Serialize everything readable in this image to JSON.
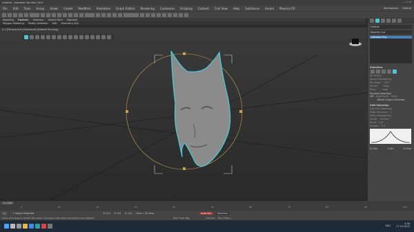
{
  "window": {
    "title": "Untitled - Autodesk 3ds Max 2023"
  },
  "menu": [
    "File",
    "Edit",
    "Tools",
    "Group",
    "Views",
    "Create",
    "Modifiers",
    "Animation",
    "Graph Editors",
    "Rendering",
    "Customize",
    "Scripting",
    "Content",
    "Civil View",
    "Help",
    "Substance",
    "Arnold",
    "Phoenix FD"
  ],
  "workspace": {
    "label": "Workspaces:",
    "value": "Default"
  },
  "ribbon_tabs": [
    "Modeling",
    "Freeform",
    "Selection",
    "Object Paint",
    "Populate"
  ],
  "ribbon_sub": [
    "Polygon Modeling",
    "Modify Selection",
    "Edit",
    "Geometry (All)"
  ],
  "viewport_label": "[+] [Perspective] [Standard] [Default Shading]",
  "cmd": {
    "header": "Default",
    "modifier_list": "Modifier List",
    "stack_item": "Editable Poly",
    "selection_title": "Selection",
    "by_vertex": "By Vertex",
    "ignore_backfacing": "Ignore Backfacing",
    "by_angle": "By Angle:",
    "angle_value": "45.0",
    "shrink": "Shrink",
    "grow": "Grow",
    "ring": "Ring",
    "loop": "Loop",
    "preview_title": "Preview Selection",
    "preview_off": "Off",
    "subobject": "SubObject",
    "multi": "Multi",
    "whole_selected": "Whole Object Selected",
    "soft_title": "Soft Selection",
    "use_soft": "Use Soft Selection",
    "edge_distance": "Edge Distance:",
    "edge_val": "1",
    "affect_backfacing": "Affect Backfacing",
    "falloff": "Falloff:",
    "falloff_val": "20.0cm",
    "pinch": "Pinch:",
    "pinch_val": "0.0",
    "bubble": "Bubble:",
    "bubble_val": "0.0",
    "curve_labels": [
      "0.25m",
      "0.0m",
      "0.25m"
    ]
  },
  "timeline": {
    "frame": "0 / 100",
    "ticks": [
      "0",
      "10",
      "20",
      "30",
      "40",
      "50",
      "60",
      "70",
      "80",
      "90",
      "100"
    ]
  },
  "status": {
    "selected": "1 Object Selected",
    "hint": "Click and drag to rotate the view.  Clicking in the tabs constrains the rotation",
    "x": "X: 0.0",
    "y": "Y: 0.0",
    "z": "Z: 0.0",
    "grid": "Grid = 10.0cm",
    "add_time_tag": "Add Time Tag",
    "autokey": "Auto Key",
    "selected_btn": "Selected",
    "setkey": "Set Key",
    "keyfilters": "Key Filters..."
  },
  "taskbar": {
    "time": "4:06",
    "date": "17.10.2023",
    "lang": "ENG"
  }
}
